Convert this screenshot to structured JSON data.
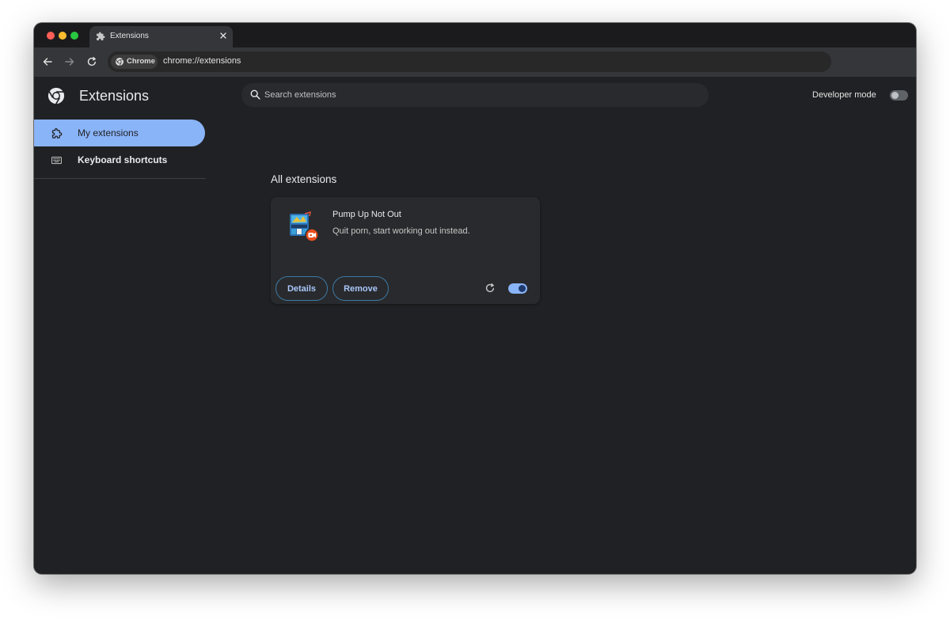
{
  "browser": {
    "tab": {
      "title": "Extensions",
      "icon": "puzzle-icon"
    },
    "omnibox": {
      "chip_label": "Chrome",
      "url": "chrome://extensions"
    }
  },
  "header": {
    "title": "Extensions",
    "search_placeholder": "Search extensions",
    "developer_mode_label": "Developer mode",
    "developer_mode_on": false
  },
  "sidebar": {
    "items": [
      {
        "label": "My extensions",
        "icon": "puzzle-outline-icon",
        "active": true
      },
      {
        "label": "Keyboard shortcuts",
        "icon": "keyboard-icon",
        "active": false
      }
    ]
  },
  "main": {
    "section_title": "All extensions",
    "extensions": [
      {
        "name": "Pump Up Not Out",
        "description": "Quit porn, start working out instead.",
        "details_label": "Details",
        "remove_label": "Remove",
        "enabled": true
      }
    ]
  },
  "colors": {
    "accent": "#8ab4f8",
    "page_bg": "#202124",
    "card_bg": "#292a2d"
  }
}
